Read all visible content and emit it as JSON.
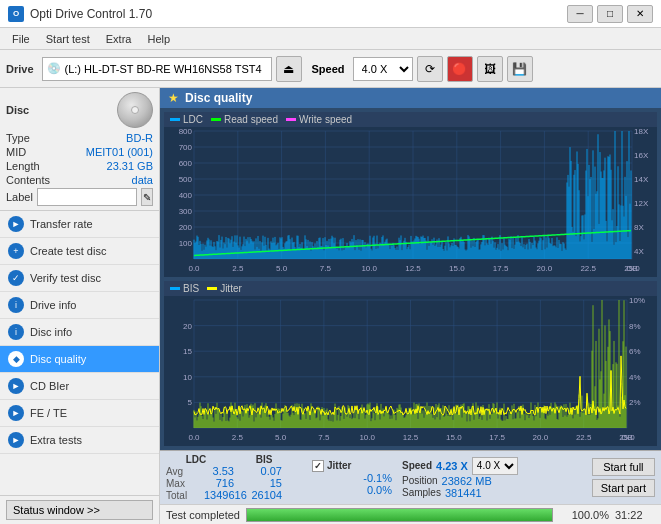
{
  "titlebar": {
    "title": "Opti Drive Control 1.70",
    "icon_text": "OD",
    "minimize": "─",
    "maximize": "□",
    "close": "✕"
  },
  "menubar": {
    "items": [
      "File",
      "Start test",
      "Extra",
      "Help"
    ]
  },
  "toolbar": {
    "drive_label": "Drive",
    "drive_icon": "💿",
    "drive_value": "(L:)  HL-DT-ST BD-RE  WH16NS58 TST4",
    "eject_icon": "⏏",
    "speed_label": "Speed",
    "speed_value": "4.0 X"
  },
  "disc_panel": {
    "title": "Disc",
    "type_label": "Type",
    "type_value": "BD-R",
    "mid_label": "MID",
    "mid_value": "MEIT01 (001)",
    "length_label": "Length",
    "length_value": "23.31 GB",
    "contents_label": "Contents",
    "contents_value": "data",
    "label_label": "Label"
  },
  "nav_items": [
    {
      "id": "transfer-rate",
      "label": "Transfer rate",
      "icon": "►"
    },
    {
      "id": "create-test",
      "label": "Create test disc",
      "icon": "+"
    },
    {
      "id": "verify-test",
      "label": "Verify test disc",
      "icon": "✓"
    },
    {
      "id": "drive-info",
      "label": "Drive info",
      "icon": "i"
    },
    {
      "id": "disc-info",
      "label": "Disc info",
      "icon": "i"
    },
    {
      "id": "disc-quality",
      "label": "Disc quality",
      "icon": "◆",
      "active": true
    },
    {
      "id": "cd-bier",
      "label": "CD BIer",
      "icon": "►"
    },
    {
      "id": "fe-te",
      "label": "FE / TE",
      "icon": "►"
    },
    {
      "id": "extra-tests",
      "label": "Extra tests",
      "icon": "►"
    }
  ],
  "status_window": {
    "button_label": "Status window >>"
  },
  "chart": {
    "title": "Disc quality",
    "icon": "★",
    "legend_top": [
      {
        "id": "ldc",
        "label": "LDC",
        "color": "#00aaff"
      },
      {
        "id": "read",
        "label": "Read speed",
        "color": "#00ff44"
      },
      {
        "id": "write",
        "label": "Write speed",
        "color": "#ff44ff"
      }
    ],
    "legend_bottom": [
      {
        "id": "bis",
        "label": "BIS",
        "color": "#00aaff"
      },
      {
        "id": "jitter",
        "label": "Jitter",
        "color": "#ffff00"
      }
    ],
    "x_labels": [
      "0.0",
      "2.5",
      "5.0",
      "7.5",
      "10.0",
      "12.5",
      "15.0",
      "17.5",
      "20.0",
      "22.5",
      "25.0"
    ],
    "x_unit": "GB",
    "top_y_labels": [
      "100",
      "200",
      "300",
      "400",
      "500",
      "600",
      "700",
      "800"
    ],
    "top_y_right": [
      "4X",
      "8X",
      "12X",
      "14X",
      "16X",
      "18X"
    ],
    "bottom_y_labels": [
      "5",
      "10",
      "15",
      "20"
    ],
    "bottom_y_right": [
      "2%",
      "4%",
      "6%",
      "8%",
      "10%"
    ]
  },
  "stats": {
    "ldc_label": "LDC",
    "bis_label": "BIS",
    "jitter_label": "Jitter",
    "speed_label": "Speed",
    "position_label": "Position",
    "samples_label": "Samples",
    "avg_label": "Avg",
    "max_label": "Max",
    "total_label": "Total",
    "ldc_avg": "3.53",
    "ldc_max": "716",
    "ldc_total": "1349616",
    "bis_avg": "0.07",
    "bis_max": "15",
    "bis_total": "26104",
    "jitter_avg": "-0.1%",
    "jitter_max": "0.0%",
    "speed_val": "4.23 X",
    "speed_select": "4.0 X",
    "position_val": "23862 MB",
    "samples_val": "381441",
    "jitter_checked": true,
    "button_full": "Start full",
    "button_part": "Start part"
  },
  "progress": {
    "status_text": "Test completed",
    "percent": 100,
    "percent_text": "100.0%",
    "time_text": "31:22"
  }
}
